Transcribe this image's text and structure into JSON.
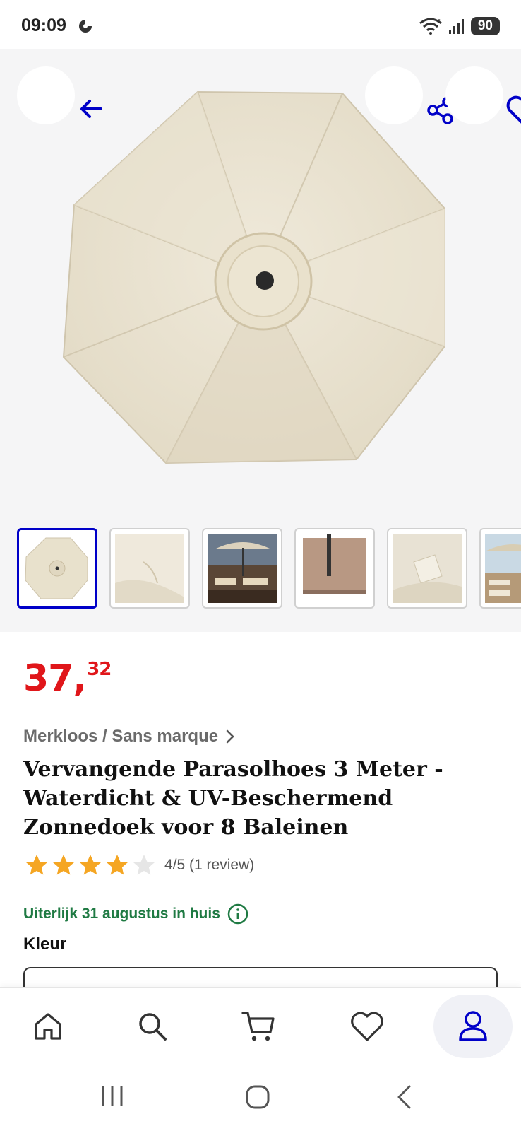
{
  "status_bar": {
    "time": "09:09",
    "network_badge": "6",
    "battery": "90"
  },
  "gallery": {
    "icons": {
      "back": "arrow-left-icon",
      "share": "share-icon",
      "favorite": "heart-outline-icon"
    },
    "thumbnails": [
      {
        "name": "umbrella-top-view",
        "active": true
      },
      {
        "name": "fabric-closeup",
        "active": false
      },
      {
        "name": "terrace-loungers",
        "active": false
      },
      {
        "name": "pole-detail",
        "active": false
      },
      {
        "name": "fabric-label",
        "active": false
      },
      {
        "name": "poolside",
        "active": false
      }
    ]
  },
  "product": {
    "price_whole": "37",
    "price_separator": ",",
    "price_cents": "32",
    "brand": "Merkloos / Sans marque",
    "title": "Vervangende Parasolhoes 3 Meter - Waterdicht & UV-Beschermend Zonnedoek voor 8 Baleinen",
    "rating_value": 4,
    "rating_max": 5,
    "rating_text": "4/5 (1 review)",
    "delivery_text": "Uiterlijk 31 augustus in huis",
    "color_label": "Kleur"
  },
  "bottom_nav": {
    "items": [
      {
        "icon": "home-icon",
        "active": false
      },
      {
        "icon": "search-icon",
        "active": false
      },
      {
        "icon": "cart-icon",
        "active": false
      },
      {
        "icon": "heart-icon",
        "active": false
      },
      {
        "icon": "account-icon",
        "active": true
      }
    ]
  },
  "colors": {
    "accent": "#0000c8",
    "price": "#e0161a",
    "delivery": "#1f7a43",
    "star": "#f5a623"
  }
}
